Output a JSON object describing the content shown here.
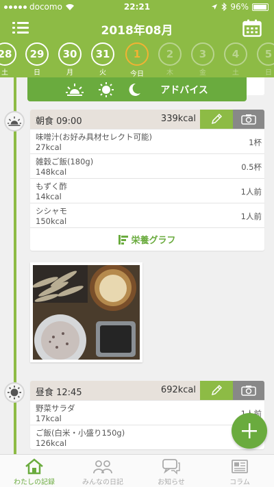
{
  "status_bar": {
    "carrier": "docomo",
    "time": "22:21",
    "battery": "96%"
  },
  "header": {
    "month_title": "2018年08月",
    "days": [
      {
        "num": "28",
        "dow": "土",
        "state": "past"
      },
      {
        "num": "29",
        "dow": "日",
        "state": "past"
      },
      {
        "num": "30",
        "dow": "月",
        "state": "past"
      },
      {
        "num": "31",
        "dow": "火",
        "state": "past"
      },
      {
        "num": "1",
        "dow": "今日",
        "state": "today"
      },
      {
        "num": "2",
        "dow": "木",
        "state": "future"
      },
      {
        "num": "3",
        "dow": "金",
        "state": "future"
      },
      {
        "num": "4",
        "dow": "土",
        "state": "future"
      },
      {
        "num": "5",
        "dow": "日",
        "state": "future"
      }
    ]
  },
  "advice": {
    "label": "アドバイス"
  },
  "meals": [
    {
      "title": "朝食 09:00",
      "kcal": "339kcal",
      "items": [
        {
          "name": "味噌汁(お好み具材セレクト可能)",
          "kcal": "27kcal",
          "qty": "1杯"
        },
        {
          "name": "雑穀ご飯(180g)",
          "kcal": "148kcal",
          "qty": "0.5杯"
        },
        {
          "name": "もずく酢",
          "kcal": "14kcal",
          "qty": "1人前"
        },
        {
          "name": "シシャモ",
          "kcal": "150kcal",
          "qty": "1人前"
        }
      ],
      "nutrition_label": "栄養グラフ"
    },
    {
      "title": "昼食 12:45",
      "kcal": "692kcal",
      "items": [
        {
          "name": "野菜サラダ",
          "kcal": "17kcal",
          "qty": "1人前"
        },
        {
          "name": "ご飯(白米・小盛り150g)",
          "kcal": "126kcal",
          "qty": ""
        }
      ]
    }
  ],
  "tabs": [
    {
      "label": "わたしの記録",
      "icon": "home-icon",
      "active": true
    },
    {
      "label": "みんなの日記",
      "icon": "people-icon",
      "active": false
    },
    {
      "label": "お知らせ",
      "icon": "chat-icon",
      "active": false
    },
    {
      "label": "コラム",
      "icon": "newspaper-icon",
      "active": false
    }
  ],
  "colors": {
    "accent": "#8dbb45",
    "accent_dark": "#6aab3e",
    "today": "#f2b233"
  }
}
